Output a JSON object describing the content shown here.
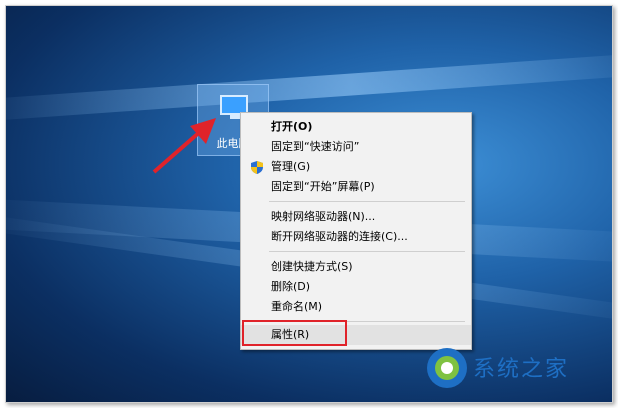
{
  "desktop_icon": {
    "label": "此电脑"
  },
  "context_menu": {
    "items": [
      {
        "label": "打开(O)",
        "bold": true
      },
      {
        "label": "固定到“快速访问”"
      },
      {
        "label": "管理(G)",
        "icon": "uac-shield-icon"
      },
      {
        "label": "固定到“开始”屏幕(P)"
      },
      {
        "label": "映射网络驱动器(N)..."
      },
      {
        "label": "断开网络驱动器的连接(C)..."
      },
      {
        "label": "创建快捷方式(S)"
      },
      {
        "label": "删除(D)"
      },
      {
        "label": "重命名(M)"
      },
      {
        "label": "属性(R)",
        "highlighted": true
      }
    ]
  },
  "watermark": {
    "text": "系统之家"
  },
  "colors": {
    "highlight_box": "#e0232a",
    "arrow": "#e0232a",
    "menu_bg": "#f2f2f2"
  }
}
